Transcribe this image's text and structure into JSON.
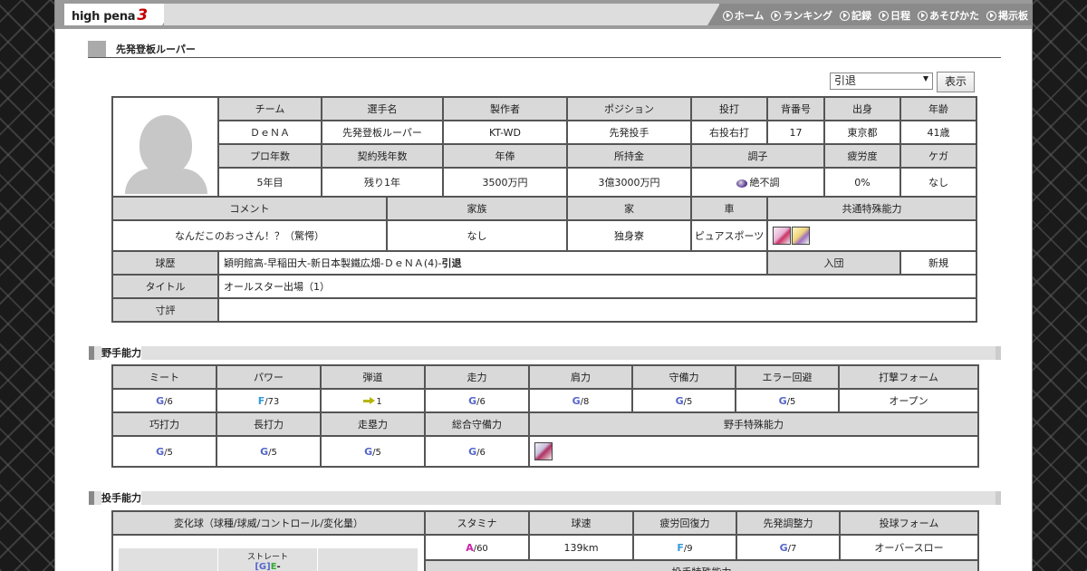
{
  "header": {
    "logo_text": "high pena",
    "logo_number": "3",
    "nav": [
      {
        "label": "ホーム"
      },
      {
        "label": "ランキング"
      },
      {
        "label": "記録"
      },
      {
        "label": "日程"
      },
      {
        "label": "あそびかた"
      },
      {
        "label": "掲示板"
      }
    ]
  },
  "page_title": "先発登板ルーパー",
  "controls": {
    "select_value": "引退",
    "show_button": "表示"
  },
  "profile": {
    "headers1": [
      "チーム",
      "選手名",
      "製作者",
      "ポジション",
      "投打",
      "背番号",
      "出身",
      "年齢"
    ],
    "values1": [
      "ＤｅＮＡ",
      "先発登板ルーパー",
      "KT-WD",
      "先発投手",
      "右投右打",
      "17",
      "東京都",
      "41歳"
    ],
    "headers2": [
      "プロ年数",
      "契約残年数",
      "年俸",
      "所持金",
      "調子",
      "疲労度",
      "ケガ"
    ],
    "values2": [
      "5年目",
      "残り1年",
      "3500万円",
      "3億3000万円",
      "絶不調",
      "0%",
      "なし"
    ],
    "headers3": [
      "コメント",
      "家族",
      "家",
      "車",
      "共通特殊能力"
    ],
    "values3": [
      "なんだこのおっさん！？（驚愕）",
      "なし",
      "独身寮",
      "ピュアスポーツ"
    ],
    "career_label": "球歴",
    "career_value": "穎明館高-早稲田大-新日本製鐵広畑-ＤｅＮＡ(4)-",
    "career_retired": "引退",
    "join_label": "入団",
    "join_value": "新規",
    "title_label": "タイトル",
    "title_value": "オールスター出場（1）",
    "review_label": "寸評",
    "review_value": ""
  },
  "batting": {
    "heading": "野手能力",
    "headers1": [
      "ミート",
      "パワー",
      "弾道",
      "走力",
      "肩力",
      "守備力",
      "エラー回避",
      "打撃フォーム"
    ],
    "values1": [
      {
        "grade": "G",
        "num": "/6",
        "color": "#5566cc"
      },
      {
        "grade": "F",
        "num": "/73",
        "color": "#3399dd"
      },
      {
        "arrow": true,
        "num": "1"
      },
      {
        "grade": "G",
        "num": "/6",
        "color": "#5566cc"
      },
      {
        "grade": "G",
        "num": "/8",
        "color": "#5566cc"
      },
      {
        "grade": "G",
        "num": "/5",
        "color": "#5566cc"
      },
      {
        "grade": "G",
        "num": "/5",
        "color": "#5566cc"
      },
      {
        "text": "オープン"
      }
    ],
    "headers2": [
      "巧打力",
      "長打力",
      "走塁力",
      "総合守備力",
      "野手特殊能力"
    ],
    "values2": [
      {
        "grade": "G",
        "num": "/5",
        "color": "#5566cc"
      },
      {
        "grade": "G",
        "num": "/5",
        "color": "#5566cc"
      },
      {
        "grade": "G",
        "num": "/5",
        "color": "#5566cc"
      },
      {
        "grade": "G",
        "num": "/6",
        "color": "#5566cc"
      }
    ]
  },
  "pitching": {
    "heading": "投手能力",
    "headers1": [
      "変化球（球種/球威/コントロール/変化量）",
      "スタミナ",
      "球速",
      "疲労回復力",
      "先発調整力",
      "投球フォーム"
    ],
    "values1": [
      {
        "grade": "A",
        "num": "/60",
        "color": "#cc22aa"
      },
      {
        "text": "139km"
      },
      {
        "grade": "F",
        "num": "/9",
        "color": "#3399dd"
      },
      {
        "grade": "G",
        "num": "/7",
        "color": "#5566cc"
      },
      {
        "text": "オーバースロー"
      }
    ],
    "pitch_name": "ストレート",
    "pitch_grades": [
      "[",
      "G",
      "]",
      "E",
      "-"
    ],
    "special_label": "投手特殊能力"
  }
}
